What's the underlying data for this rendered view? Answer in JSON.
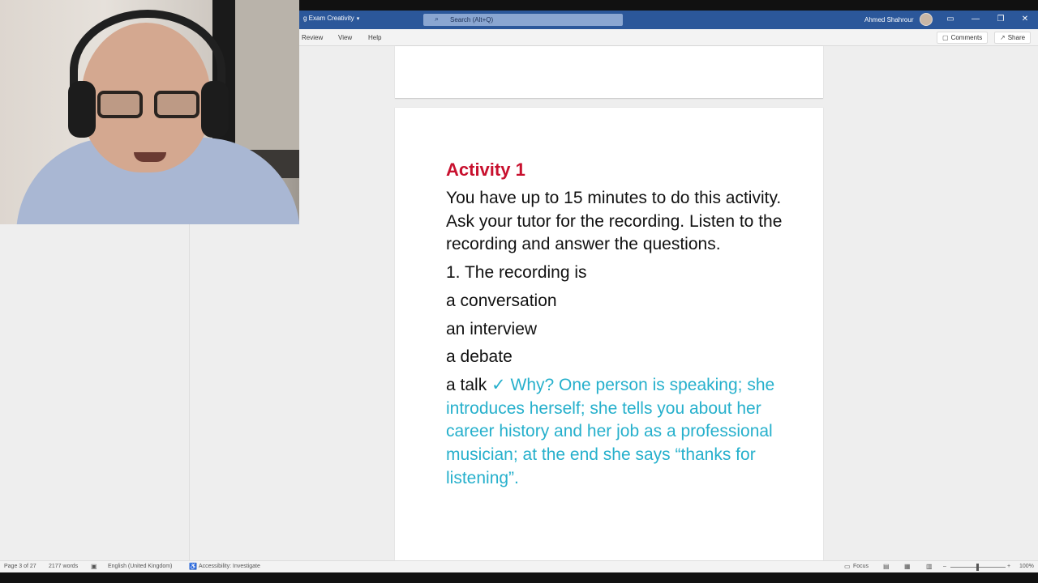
{
  "titlebar": {
    "doc_title": "g Exam Creativity",
    "search_placeholder": "Search (Alt+Q)",
    "user_name": "Ahmed Shahrour"
  },
  "ribbon": {
    "tabs": [
      {
        "label": "Review"
      },
      {
        "label": "View"
      },
      {
        "label": "Help"
      }
    ],
    "comments_label": "Comments",
    "share_label": "Share"
  },
  "document": {
    "heading": "Activity 1",
    "paragraphs": [
      "You have up to 15 minutes to do this activity. Ask your tutor for the recording. Listen to the recording and answer the questions.",
      "1. The recording is",
      "a conversation",
      "an interview",
      "a debate"
    ],
    "last_option": "a talk",
    "check_mark": "✓",
    "answer_text": "Why? One person is speaking; she introduces herself; she tells you about her career history and her job as a professional musician; at the end she says “thanks for listening”."
  },
  "statusbar": {
    "page": "Page 3 of 27",
    "words": "2177 words",
    "language": "English (United Kingdom)",
    "accessibility": "Accessibility: Investigate",
    "focus": "Focus",
    "zoom": "100%"
  },
  "colors": {
    "titlebar": "#2b579a",
    "heading": "#c8102e",
    "answer": "#26b0cc"
  }
}
